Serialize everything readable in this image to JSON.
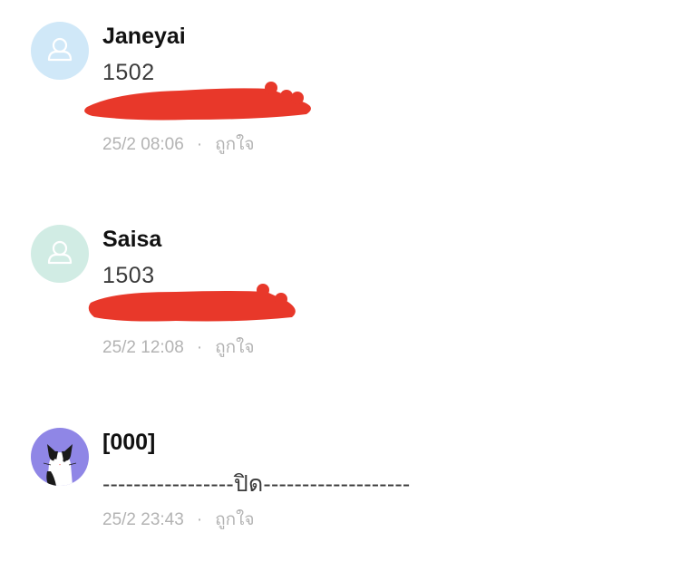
{
  "comments": [
    {
      "name": "Janeyai",
      "text": "1502",
      "time": "25/2 08:06",
      "separator": "·",
      "like_label": "ถูกใจ",
      "avatar": "default-user-icon",
      "avatar_color": "#d0e8f8"
    },
    {
      "name": "Saisa",
      "text": "1503",
      "time": "25/2 12:08",
      "separator": "·",
      "like_label": "ถูกใจ",
      "avatar": "default-user-icon",
      "avatar_color": "#d1ece4"
    },
    {
      "name": "[000]",
      "text": "-----------------ปิด-------------------",
      "time": "25/2 23:43",
      "separator": "·",
      "like_label": "ถูกใจ",
      "avatar": "cat-avatar-icon",
      "avatar_color": "#8f86e6"
    }
  ],
  "colors": {
    "redaction": "#e8382a",
    "meta_text": "#b3b3b3",
    "name_text": "#111111"
  }
}
